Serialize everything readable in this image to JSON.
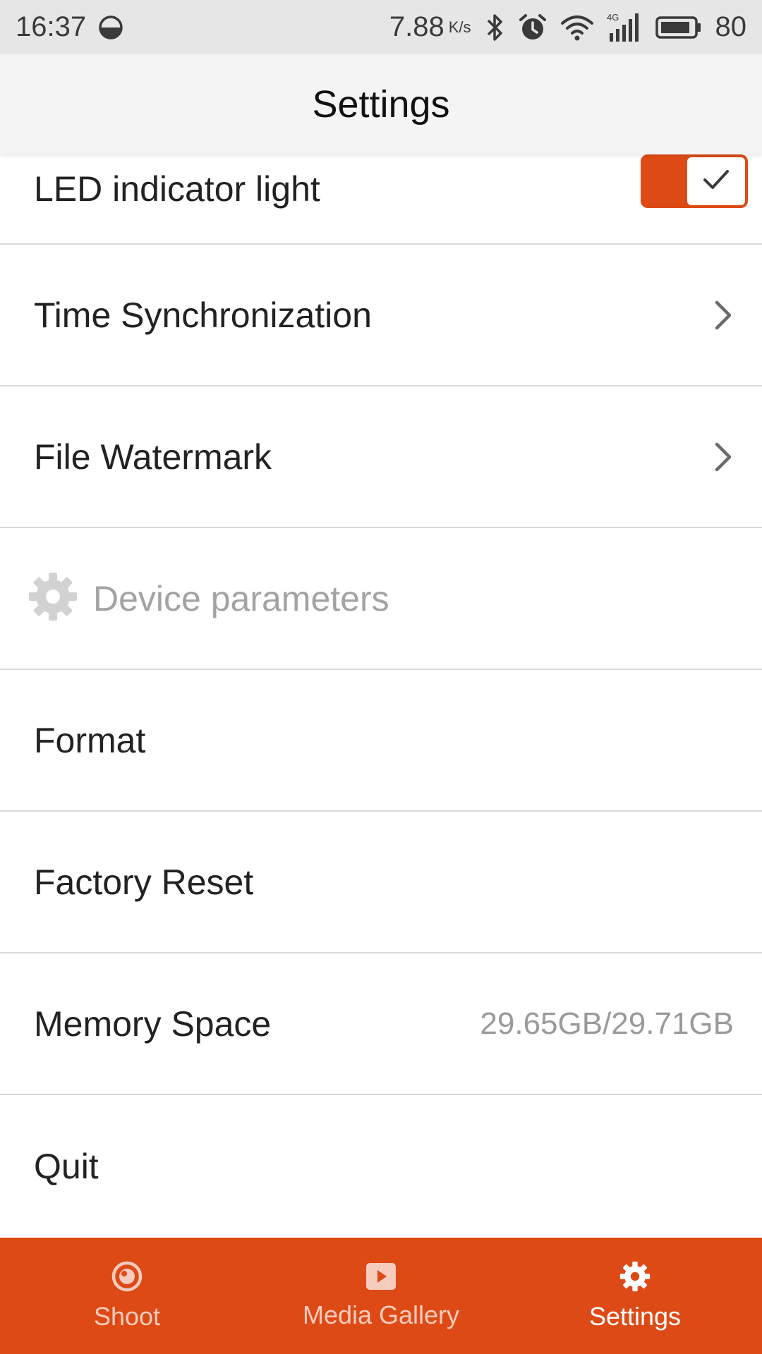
{
  "status_bar": {
    "time": "16:37",
    "network_speed": "7.88",
    "speed_unit": "K/s",
    "network_type": "4G",
    "battery": "80",
    "icons": [
      "half-moon-icon",
      "bluetooth-icon",
      "alarm-icon",
      "wifi-icon",
      "signal-icon",
      "battery-icon"
    ]
  },
  "header": {
    "title": "Settings"
  },
  "settings": {
    "led": {
      "label": "LED indicator light",
      "enabled": true
    },
    "time_sync": {
      "label": "Time Synchronization"
    },
    "watermark": {
      "label": "File Watermark"
    },
    "device_section": {
      "label": "Device parameters"
    },
    "format": {
      "label": "Format"
    },
    "factory_reset": {
      "label": "Factory Reset"
    },
    "memory": {
      "label": "Memory Space",
      "value": "29.65GB/29.71GB"
    },
    "quit": {
      "label": "Quit"
    }
  },
  "bottom_nav": {
    "items": [
      {
        "label": "Shoot",
        "icon": "camera-lens-icon",
        "active": false
      },
      {
        "label": "Media Gallery",
        "icon": "play-icon",
        "active": false
      },
      {
        "label": "Settings",
        "icon": "gear-icon",
        "active": true
      }
    ]
  },
  "colors": {
    "accent": "#dd4a15",
    "status_bar_bg": "#e6e6e6",
    "title_bar_bg": "#f4f4f4",
    "divider": "#d9d9d9",
    "muted_text": "#a3a3a3"
  }
}
